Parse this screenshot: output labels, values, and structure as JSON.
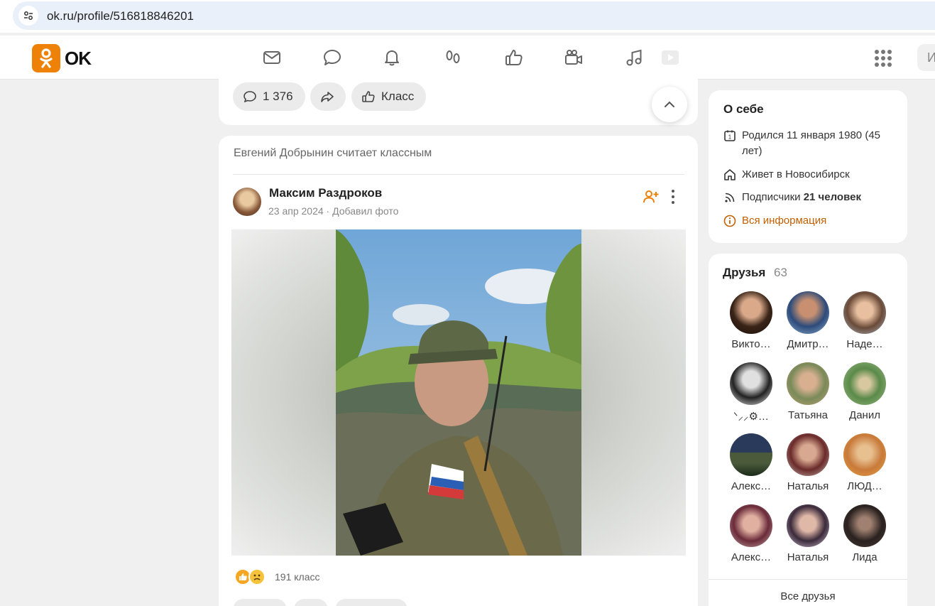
{
  "browser": {
    "url": "ok.ru/profile/516818846201"
  },
  "header": {
    "logo_text": "OK",
    "nav_icons": [
      "mail-icon",
      "chat-bubble-icon",
      "bell-icon",
      "guests-footprints-icon",
      "like-thumb-icon",
      "video-camera-icon",
      "music-note-icon",
      "video-play-icon"
    ],
    "apps_icon": "apps-grid-icon",
    "search_stub": "И"
  },
  "previous_post_actions": {
    "comments_count": "1 376",
    "class_label": "Класс"
  },
  "feed_item": {
    "context_text": "Евгений Добрынин считает классным",
    "author_name": "Максим Раздроков",
    "date": "23 апр 2024",
    "separator": "·",
    "action": "Добавил фото",
    "reactions_count": "191 класс"
  },
  "about": {
    "title": "О себе",
    "birth": "Родился 11 января 1980 (45 лет)",
    "lives_prefix": "Живет в",
    "lives_city": "Новосибирск",
    "subscribers_label": "Подписчики",
    "subscribers_value": "21 человек",
    "all_info_link": "Вся информация"
  },
  "friends": {
    "title": "Друзья",
    "count": "63",
    "items": [
      {
        "name": "Викто…"
      },
      {
        "name": "Дмитр…"
      },
      {
        "name": "Наде…"
      },
      {
        "name": "ᐠ⸝⸝⚙︎…"
      },
      {
        "name": "Татьяна"
      },
      {
        "name": "Данил"
      },
      {
        "name": "Алекс…"
      },
      {
        "name": "Наталья"
      },
      {
        "name": "ЛЮД…"
      },
      {
        "name": "Алекс…"
      },
      {
        "name": "Наталья"
      },
      {
        "name": "Лида"
      }
    ],
    "all_friends_link": "Все друзья"
  },
  "colors": {
    "brand_orange": "#ee8208",
    "link_orange": "#c25f00",
    "page_bg": "#f0f0f0"
  }
}
